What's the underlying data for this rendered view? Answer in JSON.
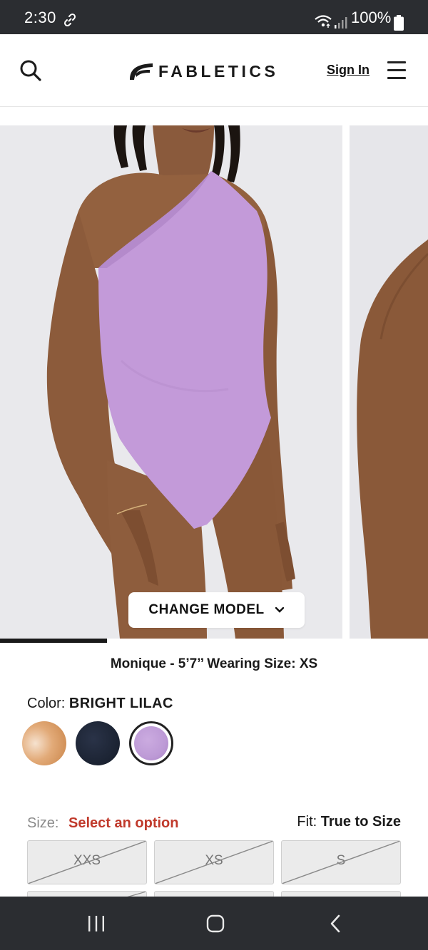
{
  "status_bar": {
    "time": "2:30",
    "battery": "100%",
    "icons": [
      "link-icon",
      "wifi-icon",
      "signal-icon",
      "battery-icon"
    ]
  },
  "header": {
    "brand": "FABLETICS",
    "sign_in": "Sign In",
    "icons": [
      "search-icon",
      "fabletics-logo-icon",
      "hamburger-menu-icon"
    ]
  },
  "gallery": {
    "change_model_label": "CHANGE MODEL",
    "progress": 0.25,
    "product_color": "#c39ad9"
  },
  "product": {
    "model_info": "Monique - 5’7’’ Wearing Size: XS",
    "color_label": "Color:",
    "color_value": "BRIGHT LILAC",
    "swatches": [
      {
        "name": "nude",
        "color": "#d79a64",
        "selected": false
      },
      {
        "name": "navy",
        "color": "#1d2535",
        "selected": false
      },
      {
        "name": "bright-lilac",
        "color": "#bd9ad6",
        "selected": true
      }
    ],
    "size_label": "Size:",
    "size_prompt": "Select an option",
    "fit_label": "Fit:",
    "fit_value": "True to Size",
    "sizes": [
      {
        "label": "XXS",
        "available": false
      },
      {
        "label": "XS",
        "available": false
      },
      {
        "label": "S",
        "available": false
      }
    ]
  },
  "colors": {
    "accent_red": "#c0392b",
    "system_bar": "#2b2d31"
  }
}
